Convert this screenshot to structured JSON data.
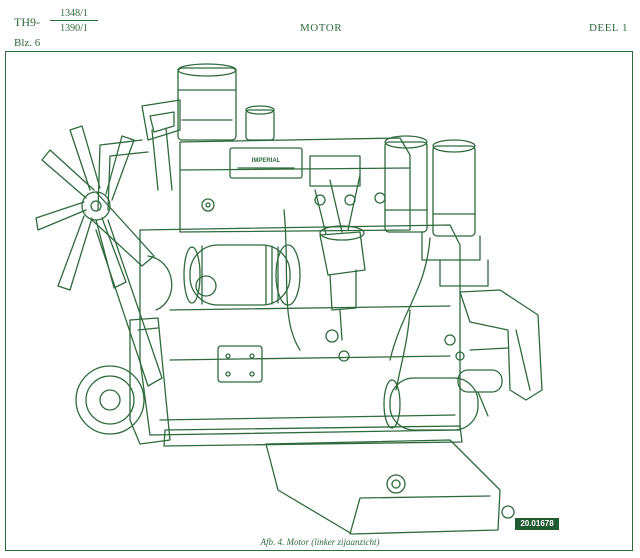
{
  "header": {
    "model_prefix": "TH9-",
    "model_numbers_top": "1348/1",
    "model_numbers_bottom": "1390/1",
    "page_ref": "Blz. 6",
    "section_title": "MOTOR",
    "part_label": "DEEL 1"
  },
  "figure": {
    "plate_label": "IMPERIAL",
    "badge_number": "20.01678",
    "caption": "Afb. 4.   Motor (linker zijaanzicht)"
  },
  "colors": {
    "ink": "#2f6a3d",
    "badge": "#1f5a30",
    "paper": "#ffffff"
  }
}
